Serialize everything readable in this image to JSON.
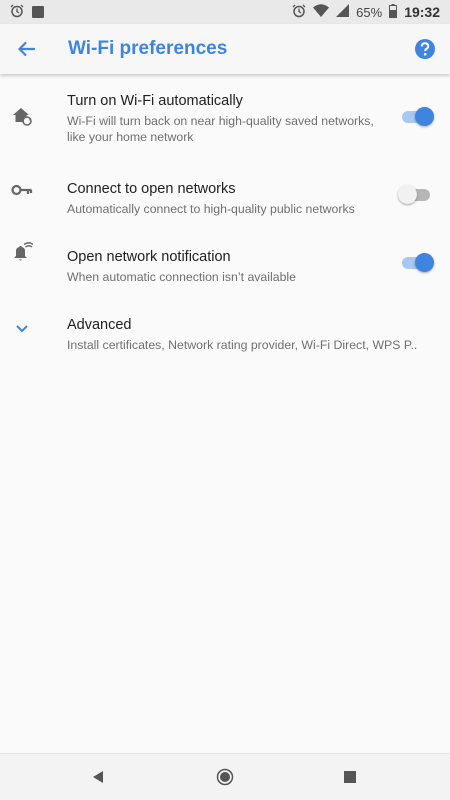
{
  "status_bar": {
    "left_icons": [
      "alarm-icon",
      "notification-square-icon"
    ],
    "right_icons": [
      "alarm-icon",
      "wifi-signal-icon",
      "cell-signal-icon"
    ],
    "battery": "65%",
    "time": "19:32"
  },
  "app_bar": {
    "title": "Wi-Fi preferences",
    "back_icon": "arrow-back-icon",
    "help_icon": "help-circle-icon"
  },
  "preferences": [
    {
      "icon": "home-autorenew-icon",
      "title": "Turn on Wi-Fi automatically",
      "summary": "Wi-Fi will turn back on near high-quality saved networks, like your home network",
      "toggle": true
    },
    {
      "icon": "key-icon",
      "title": "Connect to open networks",
      "summary": "Automatically connect to high-quality public networks",
      "toggle": false
    },
    {
      "icon": "notification-wifi-icon",
      "title": "Open network notification",
      "summary": "When automatic connection isn’t available",
      "toggle": true
    },
    {
      "icon": "chevron-down-icon",
      "title": "Advanced",
      "summary": "Install certificates, Network rating provider, Wi‑Fi Direct, WPS P.."
    }
  ],
  "nav_bar": {
    "back": "nav-back-icon",
    "home": "nav-home-icon",
    "recents": "nav-recents-icon"
  },
  "colors": {
    "accent": "#3f85e0",
    "toggle_track_on": "#a9c8f1",
    "toggle_track_off": "#b6b6b6",
    "background": "#fafafa",
    "status_bar": "#e9e9e9"
  }
}
